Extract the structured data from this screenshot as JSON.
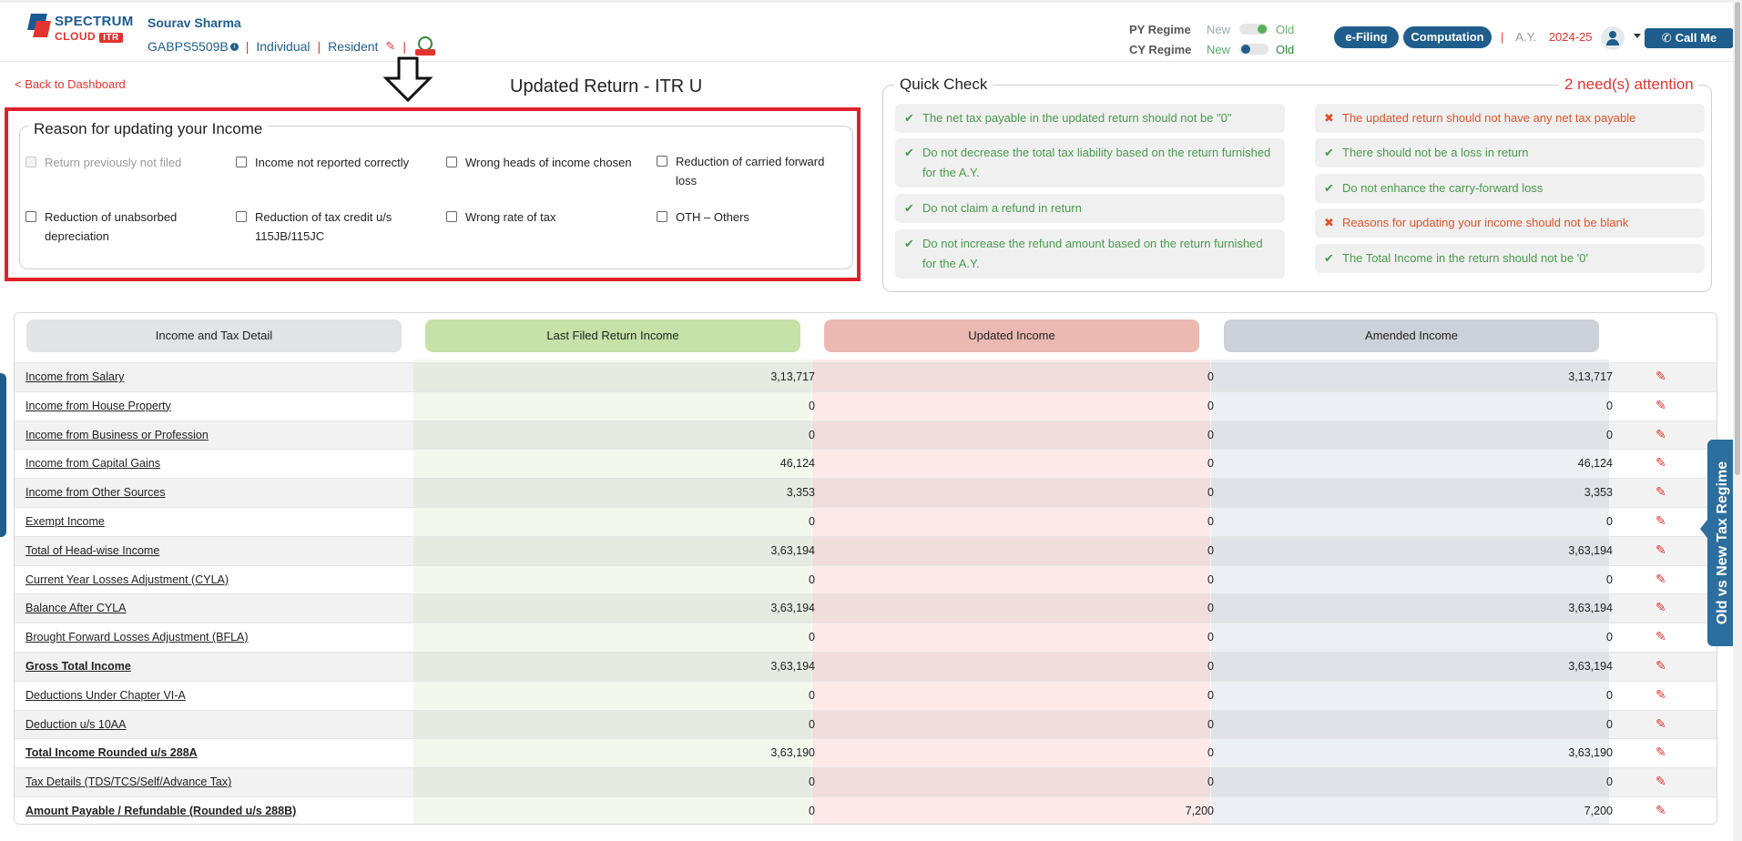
{
  "header": {
    "logo": {
      "line1": "SPECTRUM",
      "line2": "CLOUD",
      "badge": "ITR"
    },
    "user_name": "Sourav Sharma",
    "pan": "GABPS5509B",
    "info_glyph": "i",
    "status": "Individual",
    "residency": "Resident",
    "pencil_icon": "✎",
    "regimes": {
      "py_label": "PY Regime",
      "cy_label": "CY Regime",
      "new_label": "New",
      "old_label": "Old"
    },
    "efiling_label": "e-Filing",
    "computation_label": "Computation",
    "separator": "|",
    "ay_label": "A.Y.",
    "ay_value": "2024-25",
    "call_label": "Call Me",
    "phone_glyph": "✆"
  },
  "nav": {
    "back_label": "< Back to Dashboard",
    "page_title": "Updated Return - ITR U"
  },
  "reasons": {
    "legend": "Reason for updating your Income",
    "items": [
      {
        "label": "Return previously not filed"
      },
      {
        "label": "Income not reported correctly"
      },
      {
        "label": "Wrong heads of income chosen"
      },
      {
        "label": "Reduction of carried forward loss"
      },
      {
        "label": "Reduction of unabsorbed depreciation"
      },
      {
        "label": "Reduction of tax credit u/s 115JB/115JC"
      },
      {
        "label": "Wrong rate of tax"
      },
      {
        "label": "OTH – Others"
      }
    ]
  },
  "quick_check": {
    "title": "Quick Check",
    "attention": "2 need(s) attention",
    "check_glyph": "✔",
    "cross_glyph": "✖",
    "left": [
      "The net tax payable in the updated return should not be \"0\"",
      "Do not decrease the total tax liability based on the return furnished for the A.Y.",
      "Do not claim a refund in return",
      "Do not increase the refund amount based on the return furnished for the A.Y."
    ],
    "right": [
      "The updated return should not have any net tax payable",
      "There should not be a loss in return",
      "Do not enhance the carry-forward loss",
      "Reasons for updating your income should not be blank",
      "The Total Income in the return should not be '0'"
    ]
  },
  "table": {
    "headers": {
      "detail": "Income and Tax Detail",
      "last_filed": "Last Filed Return Income",
      "updated": "Updated Income",
      "amended": "Amended Income"
    },
    "rows": [
      {
        "name": "Income from Salary",
        "last": "3,13,717",
        "updated": "0",
        "amended": "3,13,717"
      },
      {
        "name": "Income from House Property",
        "last": "0",
        "updated": "0",
        "amended": "0"
      },
      {
        "name": "Income from Business or Profession",
        "last": "0",
        "updated": "0",
        "amended": "0"
      },
      {
        "name": "Income from Capital Gains",
        "last": "46,124",
        "updated": "0",
        "amended": "46,124"
      },
      {
        "name": "Income from Other Sources",
        "last": "3,353",
        "updated": "0",
        "amended": "3,353"
      },
      {
        "name": "Exempt Income",
        "last": "0",
        "updated": "0",
        "amended": "0"
      },
      {
        "name": "Total of Head-wise Income",
        "last": "3,63,194",
        "updated": "0",
        "amended": "3,63,194"
      },
      {
        "name": "Current Year Losses Adjustment (CYLA)",
        "last": "0",
        "updated": "0",
        "amended": "0"
      },
      {
        "name": "Balance After CYLA",
        "last": "3,63,194",
        "updated": "0",
        "amended": "3,63,194"
      },
      {
        "name": "Brought Forward Losses Adjustment (BFLA)",
        "last": "0",
        "updated": "0",
        "amended": "0"
      },
      {
        "name": "Gross Total Income",
        "last": "3,63,194",
        "updated": "0",
        "amended": "3,63,194"
      },
      {
        "name": "Deductions Under Chapter VI-A",
        "last": "0",
        "updated": "0",
        "amended": "0"
      },
      {
        "name": "Deduction u/s 10AA",
        "last": "0",
        "updated": "0",
        "amended": "0"
      },
      {
        "name": "Total Income Rounded u/s 288A",
        "last": "3,63,190",
        "updated": "0",
        "amended": "3,63,190"
      },
      {
        "name": "Tax Details (TDS/TCS/Self/Advance Tax)",
        "last": "0",
        "updated": "0",
        "amended": "0"
      },
      {
        "name": "Amount Payable / Refundable (Rounded u/s 288B)",
        "last": "0",
        "updated": "7,200",
        "amended": "7,200"
      }
    ]
  },
  "side_tab": {
    "label": "Old vs New Tax Regime"
  },
  "colors": {
    "brand_blue": "#1f5e8c",
    "alert_red": "#e3342f",
    "ok_green": "#4a9a4e",
    "last_filed_header": "#c6e2a8",
    "updated_header": "#ebb9b1",
    "amended_header": "#cdd1d9",
    "detail_header": "#e1e3e7"
  }
}
